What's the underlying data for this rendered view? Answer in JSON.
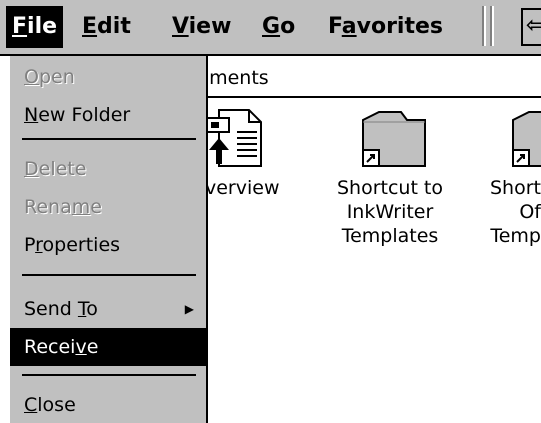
{
  "menubar": {
    "items": [
      {
        "label": "File",
        "accel": "F",
        "rest": "ile"
      },
      {
        "label": "Edit",
        "accel": "E",
        "rest": "dit"
      },
      {
        "label": "View",
        "accel": "V",
        "rest": "iew"
      },
      {
        "label": "Go",
        "accel": "G",
        "rest": "o"
      },
      {
        "label": "Favorites",
        "pre": "F",
        "accel": "a",
        "rest": "vorites"
      }
    ],
    "back_icon": "back-arrow-icon"
  },
  "address": {
    "text": "ocuments"
  },
  "files": [
    {
      "label": "verview",
      "icon": "presentation-document-icon"
    },
    {
      "label": "Shortcut to\nInkWriter\nTemplates",
      "icon": "shortcut-folder-icon"
    },
    {
      "label": "Short\nOf\nTemp",
      "icon": "shortcut-folder-icon"
    }
  ],
  "file_menu": {
    "open": {
      "accel": "O",
      "rest": "pen"
    },
    "new_folder": {
      "accel": "N",
      "rest": "ew Folder"
    },
    "delete": {
      "accel": "D",
      "rest": "elete"
    },
    "rename": {
      "pre": "Rena",
      "accel": "m",
      "rest": "e"
    },
    "properties": {
      "pre": "P",
      "accel": "r",
      "rest": "operties"
    },
    "send_to": {
      "pre": "Send ",
      "accel": "T",
      "rest": "o"
    },
    "receive": {
      "pre": "Recei",
      "accel": "v",
      "rest": "e"
    },
    "close": {
      "accel": "C",
      "rest": "lose"
    }
  },
  "colors": {
    "menu_bg": "#c0c0c0",
    "highlight": "#000000",
    "disabled_text": "#808080"
  }
}
